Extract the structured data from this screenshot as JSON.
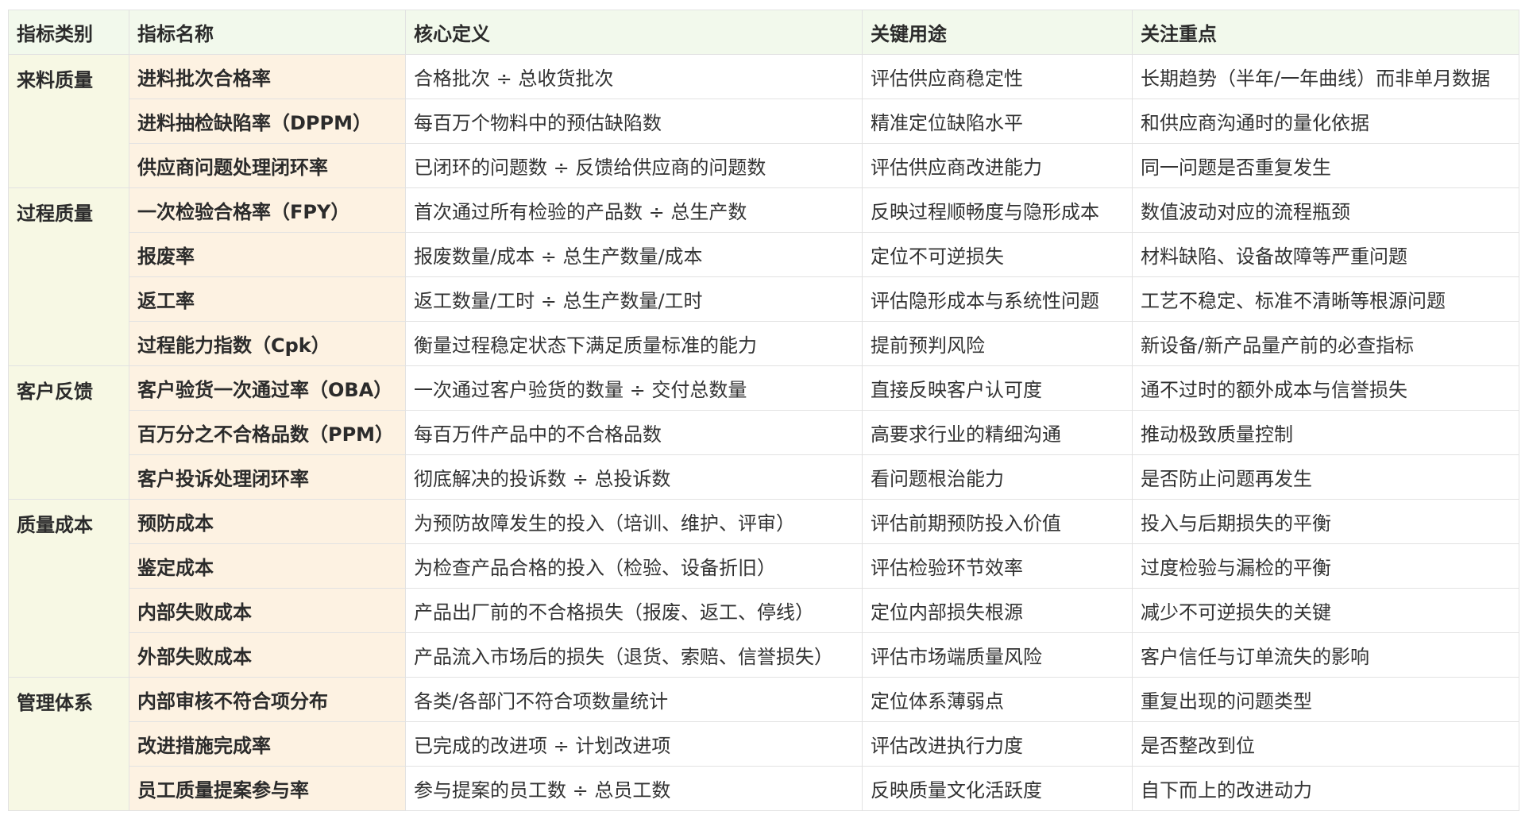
{
  "headers": [
    "指标类别",
    "指标名称",
    "核心定义",
    "关键用途",
    "关注重点"
  ],
  "groups": [
    {
      "category": "来料质量",
      "rows": [
        [
          "进料批次合格率",
          "合格批次 ÷ 总收货批次",
          "评估供应商稳定性",
          "长期趋势（半年/一年曲线）而非单月数据"
        ],
        [
          "进料抽检缺陷率（DPPM）",
          "每百万个物料中的预估缺陷数",
          "精准定位缺陷水平",
          "和供应商沟通时的量化依据"
        ],
        [
          "供应商问题处理闭环率",
          "已闭环的问题数 ÷ 反馈给供应商的问题数",
          "评估供应商改进能力",
          "同一问题是否重复发生"
        ]
      ]
    },
    {
      "category": "过程质量",
      "rows": [
        [
          "一次检验合格率（FPY）",
          "首次通过所有检验的产品数 ÷ 总生产数",
          "反映过程顺畅度与隐形成本",
          "数值波动对应的流程瓶颈"
        ],
        [
          "报废率",
          "报废数量/成本 ÷ 总生产数量/成本",
          "定位不可逆损失",
          "材料缺陷、设备故障等严重问题"
        ],
        [
          "返工率",
          "返工数量/工时 ÷ 总生产数量/工时",
          "评估隐形成本与系统性问题",
          "工艺不稳定、标准不清晰等根源问题"
        ],
        [
          "过程能力指数（Cpk）",
          "衡量过程稳定状态下满足质量标准的能力",
          "提前预判风险",
          "新设备/新产品量产前的必查指标"
        ]
      ]
    },
    {
      "category": "客户反馈",
      "rows": [
        [
          "客户验货一次通过率（OBA）",
          "一次通过客户验货的数量 ÷ 交付总数量",
          "直接反映客户认可度",
          "通不过时的额外成本与信誉损失"
        ],
        [
          "百万分之不合格品数（PPM）",
          "每百万件产品中的不合格品数",
          "高要求行业的精细沟通",
          "推动极致质量控制"
        ],
        [
          "客户投诉处理闭环率",
          "彻底解决的投诉数 ÷ 总投诉数",
          "看问题根治能力",
          "是否防止问题再发生"
        ]
      ]
    },
    {
      "category": "质量成本",
      "rows": [
        [
          "预防成本",
          "为预防故障发生的投入（培训、维护、评审）",
          "评估前期预防投入价值",
          "投入与后期损失的平衡"
        ],
        [
          "鉴定成本",
          "为检查产品合格的投入（检验、设备折旧）",
          "评估检验环节效率",
          "过度检验与漏检的平衡"
        ],
        [
          "内部失败成本",
          "产品出厂前的不合格损失（报废、返工、停线）",
          "定位内部损失根源",
          "减少不可逆损失的关键"
        ],
        [
          "外部失败成本",
          "产品流入市场后的损失（退货、索赔、信誉损失）",
          "评估市场端质量风险",
          "客户信任与订单流失的影响"
        ]
      ]
    },
    {
      "category": "管理体系",
      "rows": [
        [
          "内部审核不符合项分布",
          "各类/各部门不符合项数量统计",
          "定位体系薄弱点",
          "重复出现的问题类型"
        ],
        [
          "改进措施完成率",
          "已完成的改进项 ÷ 计划改进项",
          "评估改进执行力度",
          "是否整改到位"
        ],
        [
          "员工质量提案参与率",
          "参与提案的员工数 ÷ 总员工数",
          "反映质量文化活跃度",
          "自下而上的改进动力"
        ]
      ]
    }
  ]
}
